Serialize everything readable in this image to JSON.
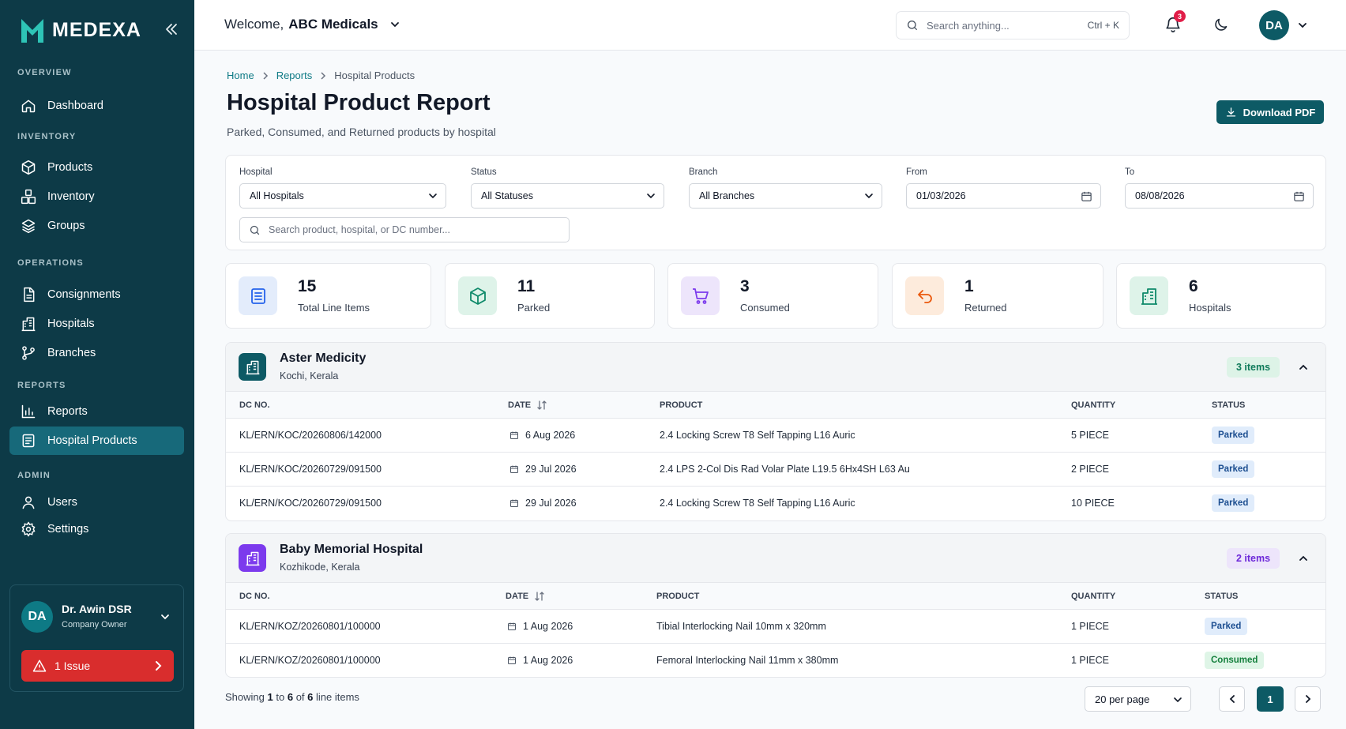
{
  "app": {
    "name": "MEDEXA"
  },
  "colors": {
    "sidebar": "#0d3a47",
    "accent": "#0d5a65",
    "active_nav": "#17697a",
    "issue": "#d92d2d"
  },
  "sidebar": {
    "sections": {
      "overview": "OVERVIEW",
      "inventory": "INVENTORY",
      "operations": "OPERATIONS",
      "reports": "REPORTS",
      "admin": "ADMIN"
    },
    "items": {
      "dashboard": "Dashboard",
      "products": "Products",
      "inventory": "Inventory",
      "groups": "Groups",
      "consignments": "Consignments",
      "hospitals": "Hospitals",
      "branches": "Branches",
      "reports": "Reports",
      "hospital_products": "Hospital Products",
      "users": "Users",
      "settings": "Settings"
    },
    "active": "hospital_products",
    "user": {
      "initials": "DA",
      "name": "Dr. Awin DSR",
      "role": "Company Owner"
    },
    "issue_label": "1 Issue"
  },
  "header": {
    "welcome_prefix": "Welcome,",
    "company": "ABC Medicals",
    "search_placeholder": "Search anything...",
    "search_shortcut": "Ctrl + K",
    "notifications": "3",
    "avatar": "DA"
  },
  "page": {
    "breadcrumb": [
      "Home",
      "Reports",
      "Hospital Products"
    ],
    "title": "Hospital Product Report",
    "subtitle": "Parked, Consumed, and Returned products by hospital",
    "download_label": "Download PDF"
  },
  "filters": {
    "hospital": {
      "label": "Hospital",
      "value": "All Hospitals"
    },
    "status": {
      "label": "Status",
      "value": "All Statuses"
    },
    "branch": {
      "label": "Branch",
      "value": "All Branches"
    },
    "from": {
      "label": "From",
      "value": "01/03/2026"
    },
    "to": {
      "label": "To",
      "value": "08/08/2026"
    },
    "search_placeholder": "Search product, hospital, or DC number..."
  },
  "stats": [
    {
      "value": "15",
      "label": "Total Line Items",
      "icon": "list-icon"
    },
    {
      "value": "11",
      "label": "Parked",
      "icon": "box-icon"
    },
    {
      "value": "3",
      "label": "Consumed",
      "icon": "cart-icon"
    },
    {
      "value": "1",
      "label": "Returned",
      "icon": "return-icon"
    },
    {
      "value": "6",
      "label": "Hospitals",
      "icon": "building-icon"
    }
  ],
  "table_headers": {
    "dc": "DC NO.",
    "date": "DATE",
    "product": "PRODUCT",
    "quantity": "QUANTITY",
    "status": "STATUS"
  },
  "groups": [
    {
      "name": "Aster Medicity",
      "location": "Kochi, Kerala",
      "count": "3 items",
      "rows": [
        {
          "dc": "KL/ERN/KOC/20260806/142000",
          "date": "6 Aug 2026",
          "product": "2.4 Locking Screw T8 Self Tapping L16 Auric",
          "quantity": "5 PIECE",
          "status": "Parked"
        },
        {
          "dc": "KL/ERN/KOC/20260729/091500",
          "date": "29 Jul 2026",
          "product": "2.4 LPS 2-Col Dis Rad Volar Plate L19.5 6Hx4SH L63 Au",
          "quantity": "2 PIECE",
          "status": "Parked"
        },
        {
          "dc": "KL/ERN/KOC/20260729/091500",
          "date": "29 Jul 2026",
          "product": "2.4 Locking Screw T8 Self Tapping L16 Auric",
          "quantity": "10 PIECE",
          "status": "Parked"
        }
      ]
    },
    {
      "name": "Baby Memorial Hospital",
      "location": "Kozhikode, Kerala",
      "count": "2 items",
      "rows": [
        {
          "dc": "KL/ERN/KOZ/20260801/100000",
          "date": "1 Aug 2026",
          "product": "Tibial Interlocking Nail 10mm x 320mm",
          "quantity": "1 PIECE",
          "status": "Parked"
        },
        {
          "dc": "KL/ERN/KOZ/20260801/100000",
          "date": "1 Aug 2026",
          "product": "Femoral Interlocking Nail 11mm x 380mm",
          "quantity": "1 PIECE",
          "status": "Consumed"
        }
      ]
    }
  ],
  "footer": {
    "showing_prefix": "Showing",
    "from": "1",
    "to_word": "to",
    "to": "6",
    "of_word": "of",
    "total": "6",
    "suffix": "line items",
    "per_page": "20 per page",
    "current_page": "1"
  }
}
